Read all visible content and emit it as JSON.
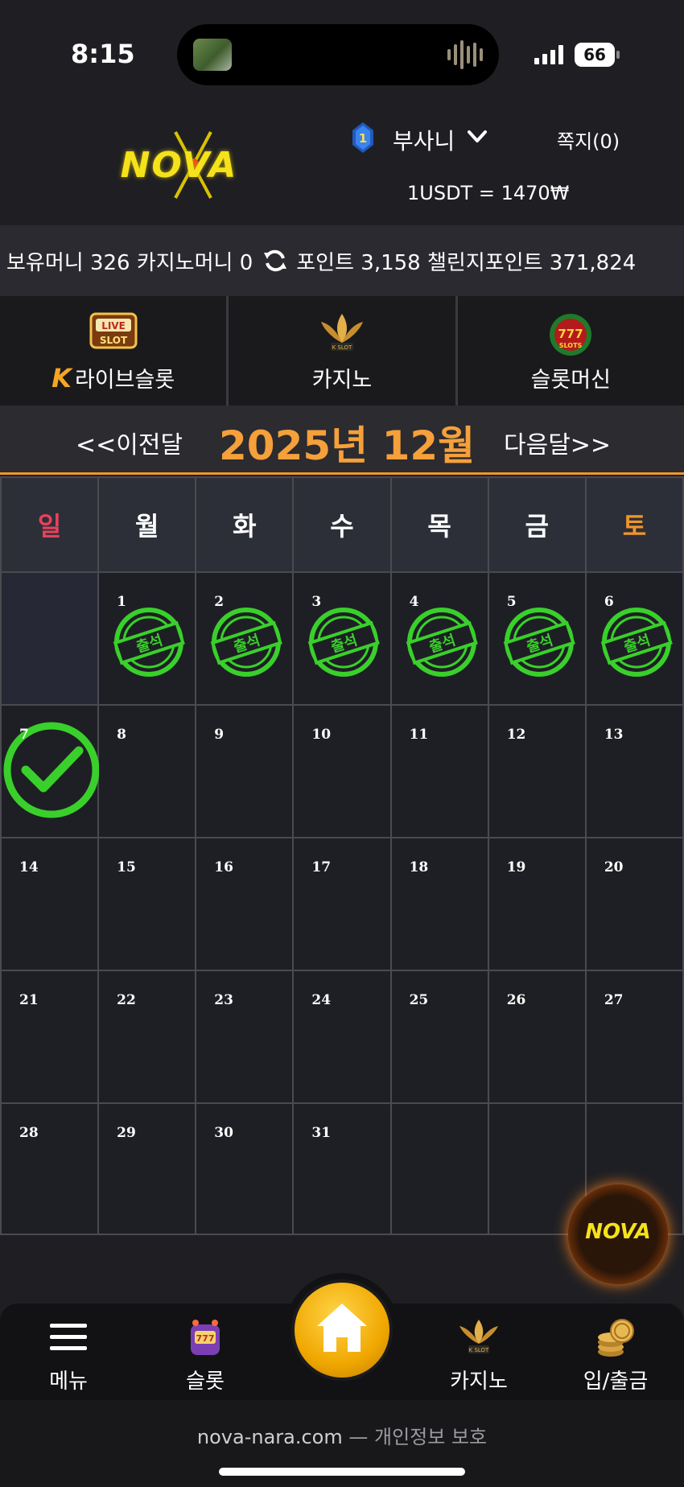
{
  "status_bar": {
    "time": "8:15",
    "battery": "66"
  },
  "header": {
    "logo": "NOVA",
    "rank_level": "1",
    "user_name": "부사니",
    "message_link": "쪽지(0)",
    "exchange_rate": "1USDT = 1470₩"
  },
  "balances": {
    "hold_money": "보유머니 326",
    "casino_money": "카지노머니 0",
    "points": "포인트 3,158",
    "challenge_points": "챌린지포인트 371,824"
  },
  "game_tabs": [
    {
      "label": "라이브슬롯",
      "icon": "live-slot-icon",
      "prefix": "K"
    },
    {
      "label": "카지노",
      "icon": "k-slot-lotus-icon"
    },
    {
      "label": "슬롯머신",
      "icon": "777-slots-icon"
    }
  ],
  "calendar": {
    "prev_label": "<<이전달",
    "month_title": "2025년 12월",
    "next_label": "다음달>>",
    "weekdays": [
      "일",
      "월",
      "화",
      "수",
      "목",
      "금",
      "토"
    ],
    "stamp_text": "출석",
    "weeks": [
      [
        "",
        "1",
        "2",
        "3",
        "4",
        "5",
        "6"
      ],
      [
        "7",
        "8",
        "9",
        "10",
        "11",
        "12",
        "13"
      ],
      [
        "14",
        "15",
        "16",
        "17",
        "18",
        "19",
        "20"
      ],
      [
        "21",
        "22",
        "23",
        "24",
        "25",
        "26",
        "27"
      ],
      [
        "28",
        "29",
        "30",
        "31",
        "",
        "",
        ""
      ]
    ],
    "attended_days": [
      "1",
      "2",
      "3",
      "4",
      "5",
      "6"
    ],
    "today": "7"
  },
  "floating_button": {
    "label": "NOVA"
  },
  "bottom_nav": {
    "menu": "메뉴",
    "slot": "슬롯",
    "casino": "카지노",
    "deposit": "입/출금"
  },
  "footer": {
    "domain": "nova-nara.com",
    "separator": " — ",
    "privacy": "개인정보 보호"
  },
  "colors": {
    "accent": "#f0962b",
    "sunday": "#e8415a",
    "stamp_green": "#39d02b",
    "bg": "#1f1f23"
  }
}
